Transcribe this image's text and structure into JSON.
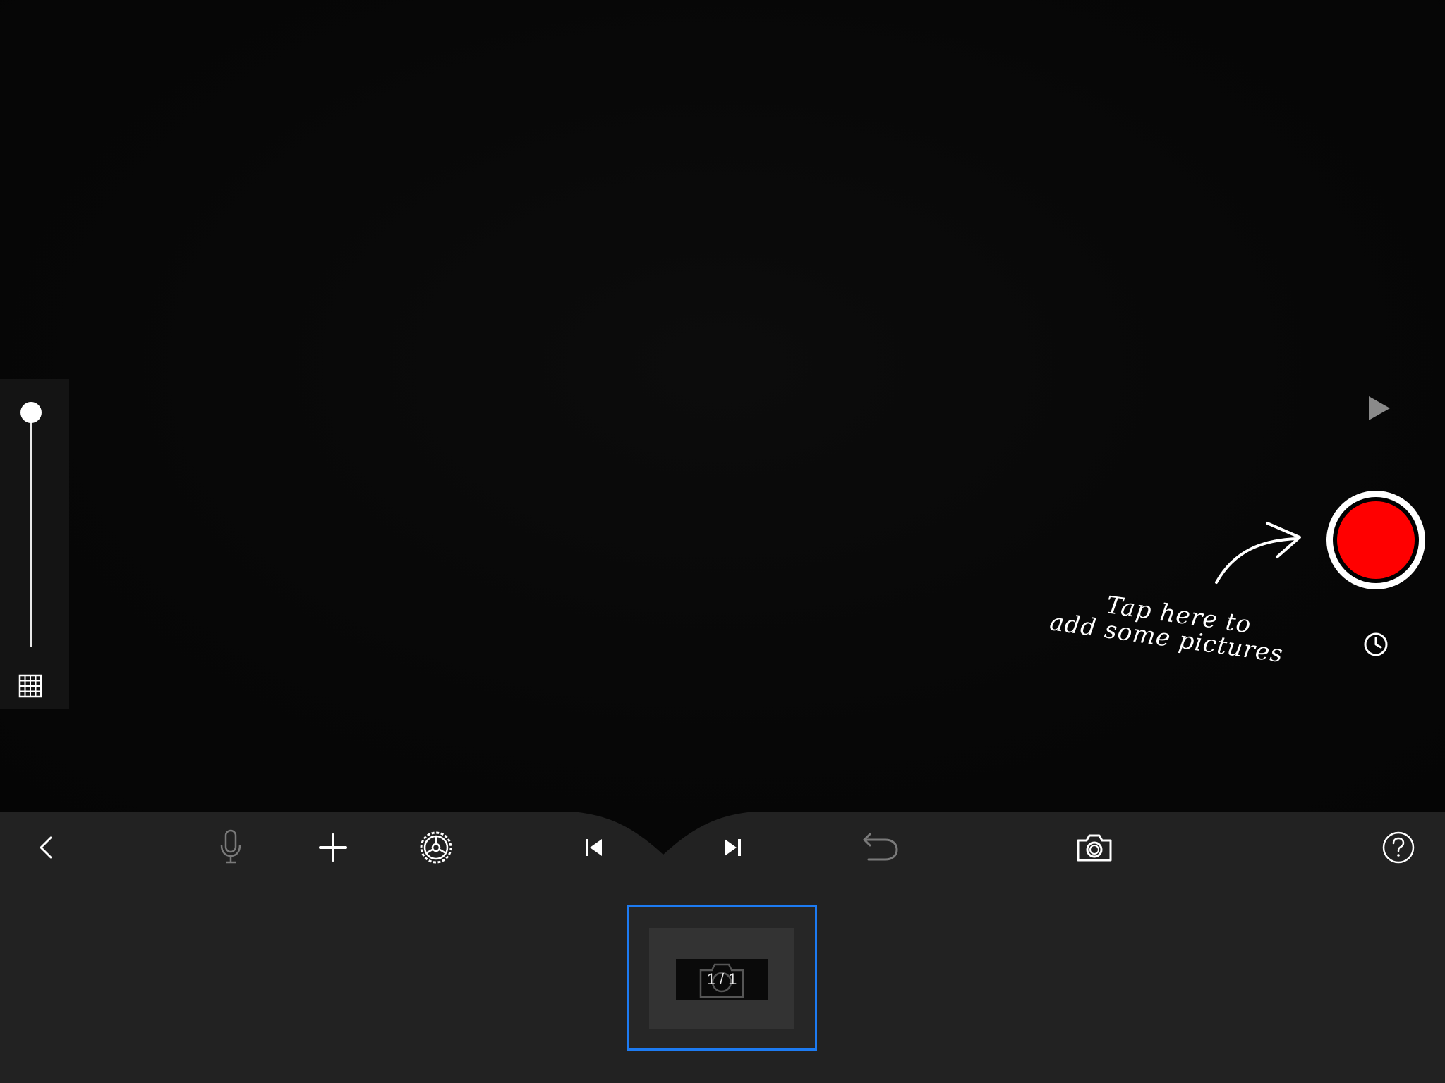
{
  "hint": {
    "line1": "Tap here to",
    "line2": "add some pictures"
  },
  "viewport": {
    "zoom_slider_level": 1.0
  },
  "icons": {
    "grid": "grid-icon",
    "play": "play-icon",
    "record": "record-icon",
    "timer": "clock-icon",
    "back": "chevron-left-icon",
    "microphone": "microphone-icon",
    "add": "plus-icon",
    "settings": "gear-icon",
    "previous": "skip-back-icon",
    "next": "skip-forward-icon",
    "undo": "undo-icon",
    "camera": "camera-icon",
    "help": "help-icon"
  },
  "filmstrip": {
    "frames": [
      {
        "counter": "1 / 1",
        "selected": true
      }
    ]
  },
  "colors": {
    "record": "#ff0000",
    "selection": "#1d7bf2",
    "toolbar": "#222222"
  }
}
